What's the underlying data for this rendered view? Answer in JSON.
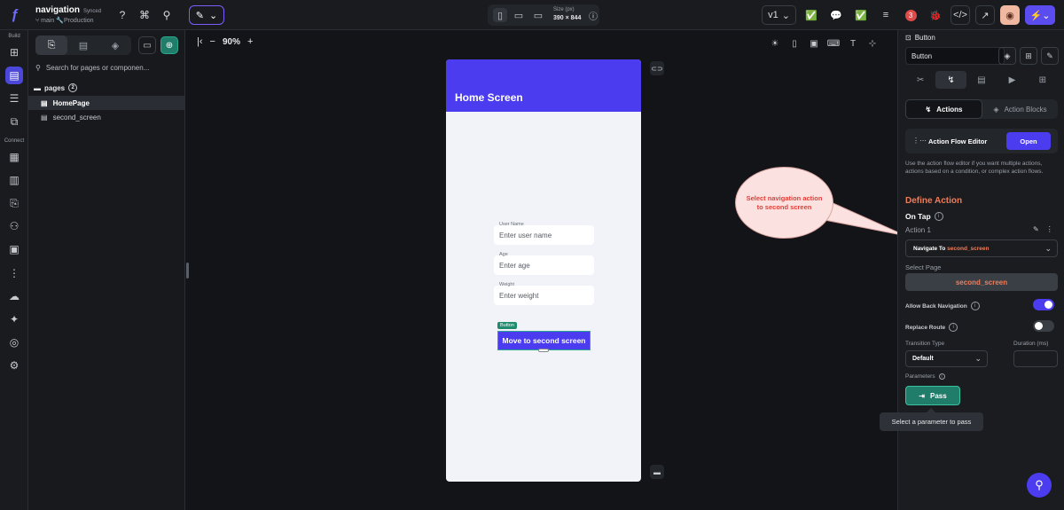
{
  "project": {
    "name": "navigation",
    "status": "Synced",
    "branch": "main",
    "environment": "Production"
  },
  "topbar": {
    "device_size_label": "Size (px)",
    "device_size_value": "390 × 844",
    "version": "v1",
    "notification_count": "3"
  },
  "left_rail": {
    "build_label": "Build",
    "connect_label": "Connect"
  },
  "pages_panel": {
    "search_placeholder": "Search for pages or componen...",
    "root_label": "pages",
    "root_count": "2",
    "items": [
      "HomePage",
      "second_screen"
    ]
  },
  "canvas": {
    "zoom": "90%",
    "appbar_title": "Home Screen",
    "fields": [
      {
        "label": "User Name",
        "placeholder": "Enter user name"
      },
      {
        "label": "Age",
        "placeholder": "Enter age"
      },
      {
        "label": "Weight",
        "placeholder": "Enter weight"
      }
    ],
    "button_tag": "Button",
    "button_label": "Move to second screen"
  },
  "callout": {
    "text": "Select navigation action to second screen"
  },
  "properties": {
    "widget_type": "Button",
    "widget_name": "Button",
    "segment_actions": "Actions",
    "segment_blocks": "Action Blocks",
    "action_flow_title": "Action Flow Editor",
    "open_label": "Open",
    "action_flow_desc": "Use the action flow editor if you want multiple actions, actions based on a condition, or complex action flows.",
    "define_action": "Define Action",
    "on_tap": "On Tap",
    "action_label": "Action 1",
    "navigate_prefix": "Navigate To",
    "navigate_dest": "second_screen",
    "select_page_label": "Select Page",
    "select_page_value": "second_screen",
    "allow_back_label": "Allow Back Navigation",
    "allow_back_on": true,
    "replace_route_label": "Replace Route",
    "replace_route_on": false,
    "transition_label": "Transition Type",
    "transition_value": "Default",
    "duration_label": "Duration (ms)",
    "parameters_label": "Parameters",
    "pass_label": "Pass",
    "tooltip": "Select a parameter to pass"
  },
  "colors": {
    "accent": "#4b3cf0",
    "highlight": "#f07d5a",
    "success": "#1f7d6a"
  }
}
